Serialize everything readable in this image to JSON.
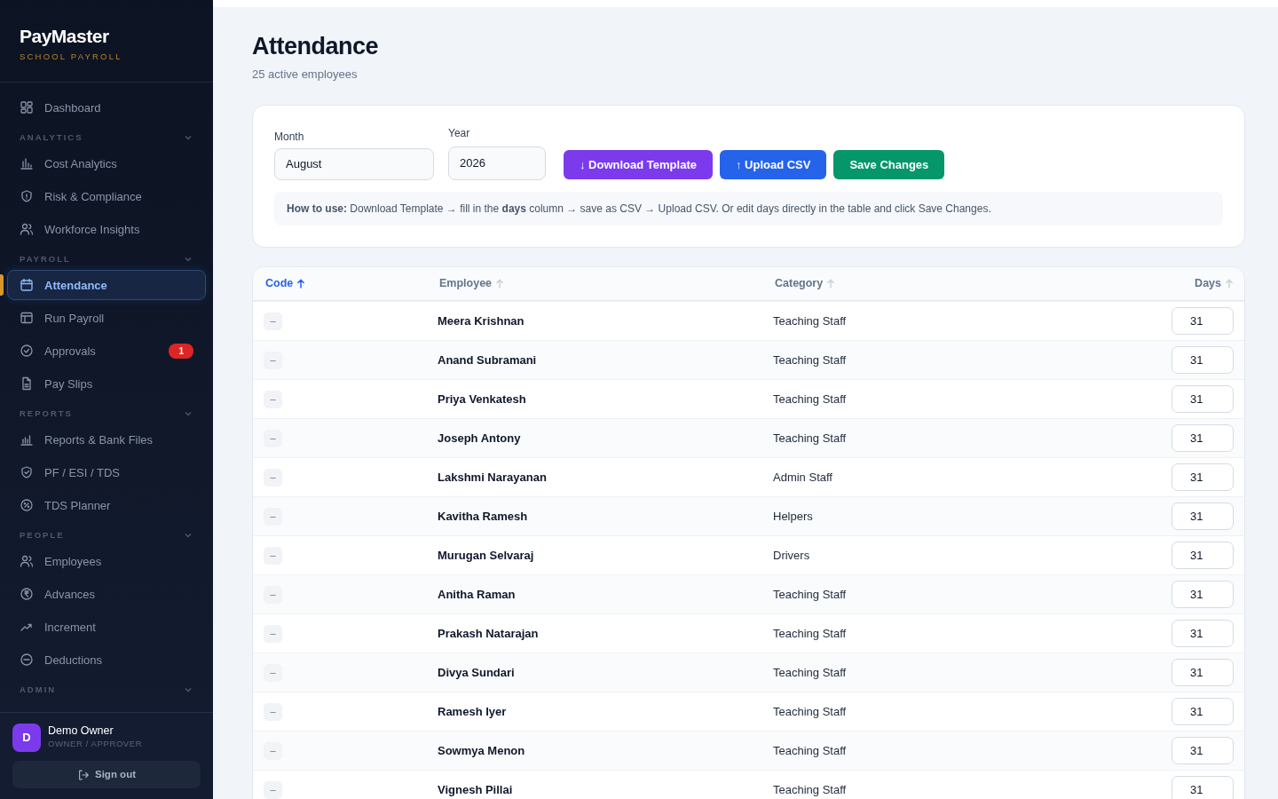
{
  "brand": {
    "name": "PayMaster",
    "tagline": "SCHOOL PAYROLL"
  },
  "nav": [
    {
      "kind": "item",
      "label": "Dashboard",
      "selected": false
    },
    {
      "kind": "section",
      "label": "ANALYTICS",
      "expanded": true
    },
    {
      "kind": "item",
      "label": "Cost Analytics",
      "selected": false
    },
    {
      "kind": "item",
      "label": "Risk & Compliance",
      "selected": false
    },
    {
      "kind": "item",
      "label": "Workforce Insights",
      "selected": false
    },
    {
      "kind": "section",
      "label": "PAYROLL",
      "expanded": true
    },
    {
      "kind": "item",
      "label": "Attendance",
      "selected": true
    },
    {
      "kind": "item",
      "label": "Run Payroll",
      "selected": false
    },
    {
      "kind": "item",
      "label": "Approvals",
      "selected": false,
      "badge": "1"
    },
    {
      "kind": "item",
      "label": "Pay Slips",
      "selected": false
    },
    {
      "kind": "section",
      "label": "REPORTS",
      "expanded": true
    },
    {
      "kind": "item",
      "label": "Reports & Bank Files",
      "selected": false
    },
    {
      "kind": "item",
      "label": "PF / ESI / TDS",
      "selected": false
    },
    {
      "kind": "item",
      "label": "TDS Planner",
      "selected": false
    },
    {
      "kind": "section",
      "label": "PEOPLE",
      "expanded": true
    },
    {
      "kind": "item",
      "label": "Employees",
      "selected": false
    },
    {
      "kind": "item",
      "label": "Advances",
      "selected": false
    },
    {
      "kind": "item",
      "label": "Increment",
      "selected": false
    },
    {
      "kind": "item",
      "label": "Deductions",
      "selected": false
    },
    {
      "kind": "section",
      "label": "ADMIN",
      "expanded": true
    }
  ],
  "user": {
    "initial": "D",
    "name": "Demo Owner",
    "role": "OWNER / APPROVER"
  },
  "sign_out": "Sign out",
  "page": {
    "title": "Attendance",
    "subtitle": "25 active employees"
  },
  "filters": {
    "month": {
      "label": "Month",
      "value": "August"
    },
    "year": {
      "label": "Year",
      "value": "2026"
    }
  },
  "buttons": [
    {
      "kind": "download",
      "label": "↓ Download Template"
    },
    {
      "kind": "upload",
      "label": "↑ Upload CSV"
    },
    {
      "kind": "save",
      "label": "Save Changes"
    }
  ],
  "help": "**How to use:** Download Template → fill in the **days** column → save as CSV → Upload CSV. Or edit days directly in the table and click Save Changes.",
  "table": {
    "columns": [
      {
        "label": "Code",
        "sorted": true
      },
      {
        "label": "Employee",
        "sorted": false
      },
      {
        "label": "Category",
        "sorted": false
      },
      {
        "label": "Days",
        "sorted": false
      }
    ],
    "rows": [
      {
        "code": "–",
        "employee": "Meera Krishnan",
        "category": "Teaching Staff",
        "days": "31"
      },
      {
        "code": "–",
        "employee": "Anand Subramani",
        "category": "Teaching Staff",
        "days": "31"
      },
      {
        "code": "–",
        "employee": "Priya Venkatesh",
        "category": "Teaching Staff",
        "days": "31"
      },
      {
        "code": "–",
        "employee": "Joseph Antony",
        "category": "Teaching Staff",
        "days": "31"
      },
      {
        "code": "–",
        "employee": "Lakshmi Narayanan",
        "category": "Admin Staff",
        "days": "31"
      },
      {
        "code": "–",
        "employee": "Kavitha Ramesh",
        "category": "Helpers",
        "days": "31"
      },
      {
        "code": "–",
        "employee": "Murugan Selvaraj",
        "category": "Drivers",
        "days": "31"
      },
      {
        "code": "–",
        "employee": "Anitha Raman",
        "category": "Teaching Staff",
        "days": "31"
      },
      {
        "code": "–",
        "employee": "Prakash Natarajan",
        "category": "Teaching Staff",
        "days": "31"
      },
      {
        "code": "–",
        "employee": "Divya Sundari",
        "category": "Teaching Staff",
        "days": "31"
      },
      {
        "code": "–",
        "employee": "Ramesh Iyer",
        "category": "Teaching Staff",
        "days": "31"
      },
      {
        "code": "–",
        "employee": "Sowmya Menon",
        "category": "Teaching Staff",
        "days": "31"
      },
      {
        "code": "–",
        "employee": "Vignesh Pillai",
        "category": "Teaching Staff",
        "days": "31"
      }
    ]
  }
}
